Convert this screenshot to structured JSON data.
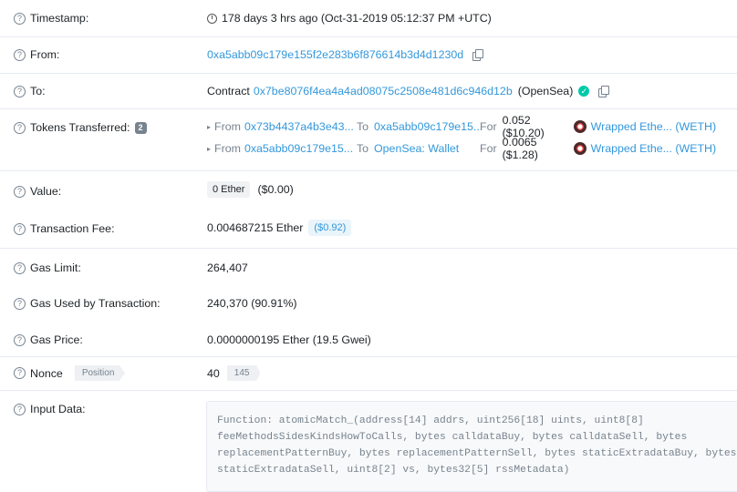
{
  "rows": {
    "timestamp": {
      "label": "Timestamp:",
      "value": "178 days 3 hrs ago (Oct-31-2019 05:12:37 PM +UTC)"
    },
    "from": {
      "label": "From:",
      "address": "0xa5abb09c179e155f2e283b6f876614b3d4d1230d"
    },
    "to": {
      "label": "To:",
      "prefix": "Contract",
      "address": "0x7be8076f4ea4a4ad08075c2508e481d6c946d12b",
      "name": "(OpenSea)"
    },
    "tokens": {
      "label": "Tokens Transferred:",
      "count": "2",
      "transfers": [
        {
          "from_label": "From",
          "from": "0x73b4437a4b3e43...",
          "to_label": "To",
          "to": "0xa5abb09c179e15...",
          "for_label": "For",
          "amount": "0.052 ($10.20)",
          "token": "Wrapped Ethe... (WETH)"
        },
        {
          "from_label": "From",
          "from": "0xa5abb09c179e15...",
          "to_label": "To",
          "to": "OpenSea: Wallet",
          "for_label": "For",
          "amount": "0.0065 ($1.28)",
          "token": "Wrapped Ethe... (WETH)"
        }
      ]
    },
    "value": {
      "label": "Value:",
      "ether": "0 Ether",
      "usd": "($0.00)"
    },
    "fee": {
      "label": "Transaction Fee:",
      "ether": "0.004687215 Ether",
      "usd": "($0.92)"
    },
    "gas_limit": {
      "label": "Gas Limit:",
      "value": "264,407"
    },
    "gas_used": {
      "label": "Gas Used by Transaction:",
      "value": "240,370 (90.91%)"
    },
    "gas_price": {
      "label": "Gas Price:",
      "value": "0.0000000195 Ether (19.5 Gwei)"
    },
    "nonce": {
      "label": "Nonce",
      "tag": "Position",
      "value": "40",
      "position": "145"
    },
    "input": {
      "label": "Input Data:",
      "lines": [
        "Function: atomicMatch_(address[14] addrs, uint256[18] uints, uint8[8]",
        "feeMethodsSidesKindsHowToCalls, bytes calldataBuy, bytes calldataSell, bytes",
        "replacementPatternBuy, bytes replacementPatternSell, bytes staticExtradataBuy, bytes",
        "staticExtradataSell, uint8[2] vs, bytes32[5] rssMetadata)"
      ]
    }
  },
  "icons": {
    "help": "question-circle-icon",
    "copy": "copy-icon",
    "verified": "check-circle-icon",
    "clock": "clock-icon",
    "token": "weth-token-icon"
  },
  "colors": {
    "link": "#3498db",
    "muted": "#77838f",
    "divider": "#e7eaf3",
    "verified": "#00c9a7"
  }
}
